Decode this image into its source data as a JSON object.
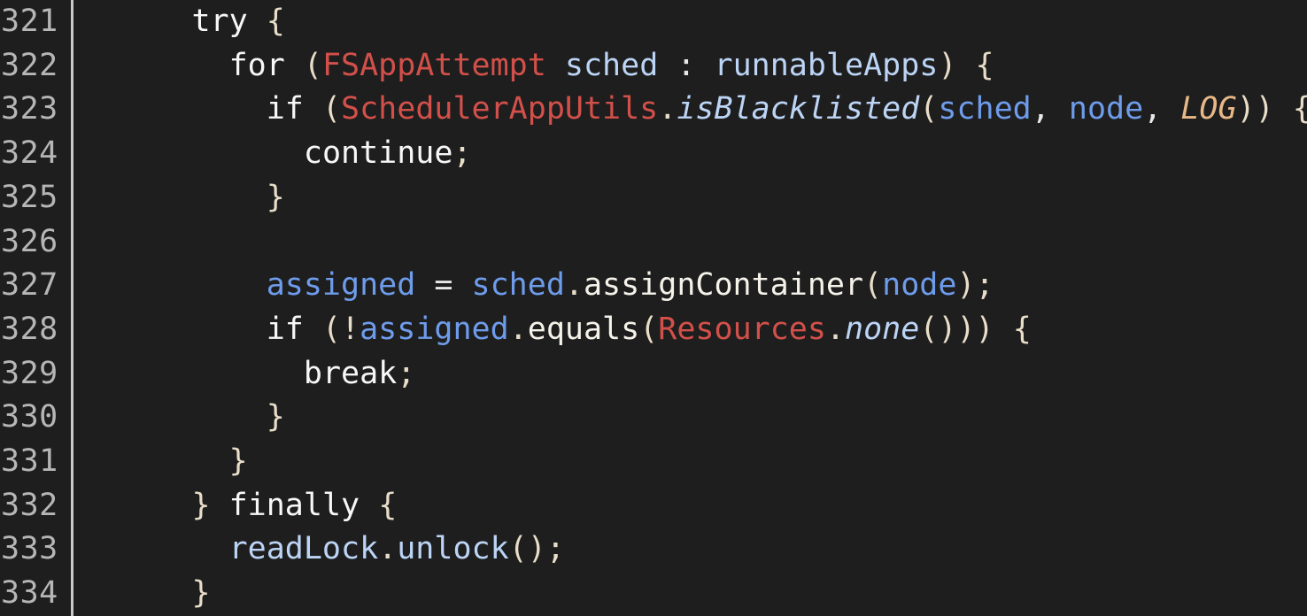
{
  "editor": {
    "background_color": "#1e1e1e",
    "gutter_separator_color": "#c9c9c9",
    "line_number_color": "#b6b6b6",
    "first_line_number": 321,
    "last_line_number": 334,
    "language": "java",
    "palette": {
      "plain": "#f2f2f2",
      "keyword": "#f7f7f7",
      "type": "#d3504a",
      "punctuation": "#e8ddc8",
      "variable": "#6e9ceb",
      "field": "#bcd4f5",
      "static_method": "#bcd4f5",
      "constant": "#e8b887",
      "method": "#f5f2ea"
    }
  },
  "lines": [
    {
      "number": "321",
      "text": "      try {",
      "tokens": [
        {
          "text": "      ",
          "kind": "plain"
        },
        {
          "text": "try",
          "kind": "keyword"
        },
        {
          "text": " ",
          "kind": "plain"
        },
        {
          "text": "{",
          "kind": "punct"
        }
      ]
    },
    {
      "number": "322",
      "text": "        for (FSAppAttempt sched : runnableApps) {",
      "tokens": [
        {
          "text": "        ",
          "kind": "plain"
        },
        {
          "text": "for",
          "kind": "keyword"
        },
        {
          "text": " ",
          "kind": "plain"
        },
        {
          "text": "(",
          "kind": "punct"
        },
        {
          "text": "FSAppAttempt",
          "kind": "type"
        },
        {
          "text": " ",
          "kind": "plain"
        },
        {
          "text": "sched",
          "kind": "field"
        },
        {
          "text": " ",
          "kind": "plain"
        },
        {
          "text": ":",
          "kind": "op"
        },
        {
          "text": " ",
          "kind": "plain"
        },
        {
          "text": "runnableApps",
          "kind": "field"
        },
        {
          "text": ")",
          "kind": "punct"
        },
        {
          "text": " ",
          "kind": "plain"
        },
        {
          "text": "{",
          "kind": "punct"
        }
      ]
    },
    {
      "number": "323",
      "text": "          if (SchedulerAppUtils.isBlacklisted(sched, node, LOG)) {",
      "tokens": [
        {
          "text": "          ",
          "kind": "plain"
        },
        {
          "text": "if",
          "kind": "keyword"
        },
        {
          "text": " ",
          "kind": "plain"
        },
        {
          "text": "(",
          "kind": "punct"
        },
        {
          "text": "SchedulerAppUtils",
          "kind": "type"
        },
        {
          "text": ".",
          "kind": "punct"
        },
        {
          "text": "isBlacklisted",
          "kind": "static"
        },
        {
          "text": "(",
          "kind": "punct"
        },
        {
          "text": "sched",
          "kind": "var"
        },
        {
          "text": ",",
          "kind": "op"
        },
        {
          "text": " ",
          "kind": "plain"
        },
        {
          "text": "node",
          "kind": "var"
        },
        {
          "text": ",",
          "kind": "op"
        },
        {
          "text": " ",
          "kind": "plain"
        },
        {
          "text": "LOG",
          "kind": "const"
        },
        {
          "text": ")",
          "kind": "punct"
        },
        {
          "text": ")",
          "kind": "punct"
        },
        {
          "text": " ",
          "kind": "plain"
        },
        {
          "text": "{",
          "kind": "punct"
        }
      ]
    },
    {
      "number": "324",
      "text": "            continue;",
      "tokens": [
        {
          "text": "            ",
          "kind": "plain"
        },
        {
          "text": "continue",
          "kind": "keyword"
        },
        {
          "text": ";",
          "kind": "punct"
        }
      ]
    },
    {
      "number": "325",
      "text": "          }",
      "tokens": [
        {
          "text": "          ",
          "kind": "plain"
        },
        {
          "text": "}",
          "kind": "punct"
        }
      ]
    },
    {
      "number": "326",
      "text": "",
      "tokens": []
    },
    {
      "number": "327",
      "text": "          assigned = sched.assignContainer(node);",
      "tokens": [
        {
          "text": "          ",
          "kind": "plain"
        },
        {
          "text": "assigned",
          "kind": "var"
        },
        {
          "text": " ",
          "kind": "plain"
        },
        {
          "text": "=",
          "kind": "op"
        },
        {
          "text": " ",
          "kind": "plain"
        },
        {
          "text": "sched",
          "kind": "var"
        },
        {
          "text": ".",
          "kind": "punct"
        },
        {
          "text": "assignContainer",
          "kind": "method"
        },
        {
          "text": "(",
          "kind": "punct"
        },
        {
          "text": "node",
          "kind": "var"
        },
        {
          "text": ")",
          "kind": "punct"
        },
        {
          "text": ";",
          "kind": "punct"
        }
      ]
    },
    {
      "number": "328",
      "text": "          if (!assigned.equals(Resources.none())) {",
      "tokens": [
        {
          "text": "          ",
          "kind": "plain"
        },
        {
          "text": "if",
          "kind": "keyword"
        },
        {
          "text": " ",
          "kind": "plain"
        },
        {
          "text": "(",
          "kind": "punct"
        },
        {
          "text": "!",
          "kind": "punct"
        },
        {
          "text": "assigned",
          "kind": "var"
        },
        {
          "text": ".",
          "kind": "punct"
        },
        {
          "text": "equals",
          "kind": "method"
        },
        {
          "text": "(",
          "kind": "punct"
        },
        {
          "text": "Resources",
          "kind": "type"
        },
        {
          "text": ".",
          "kind": "punct"
        },
        {
          "text": "none",
          "kind": "static"
        },
        {
          "text": "(",
          "kind": "punct"
        },
        {
          "text": ")",
          "kind": "punct"
        },
        {
          "text": ")",
          "kind": "punct"
        },
        {
          "text": ")",
          "kind": "punct"
        },
        {
          "text": " ",
          "kind": "plain"
        },
        {
          "text": "{",
          "kind": "punct"
        }
      ]
    },
    {
      "number": "329",
      "text": "            break;",
      "tokens": [
        {
          "text": "            ",
          "kind": "plain"
        },
        {
          "text": "break",
          "kind": "keyword"
        },
        {
          "text": ";",
          "kind": "punct"
        }
      ]
    },
    {
      "number": "330",
      "text": "          }",
      "tokens": [
        {
          "text": "          ",
          "kind": "plain"
        },
        {
          "text": "}",
          "kind": "punct"
        }
      ]
    },
    {
      "number": "331",
      "text": "        }",
      "tokens": [
        {
          "text": "        ",
          "kind": "plain"
        },
        {
          "text": "}",
          "kind": "punct"
        }
      ]
    },
    {
      "number": "332",
      "text": "      } finally {",
      "tokens": [
        {
          "text": "      ",
          "kind": "plain"
        },
        {
          "text": "}",
          "kind": "punct"
        },
        {
          "text": " ",
          "kind": "plain"
        },
        {
          "text": "finally",
          "kind": "keyword"
        },
        {
          "text": " ",
          "kind": "plain"
        },
        {
          "text": "{",
          "kind": "punct"
        }
      ]
    },
    {
      "number": "333",
      "text": "        readLock.unlock();",
      "tokens": [
        {
          "text": "        ",
          "kind": "plain"
        },
        {
          "text": "readLock",
          "kind": "field"
        },
        {
          "text": ".",
          "kind": "punct"
        },
        {
          "text": "unlock",
          "kind": "field"
        },
        {
          "text": "(",
          "kind": "punct"
        },
        {
          "text": ")",
          "kind": "punct"
        },
        {
          "text": ";",
          "kind": "punct"
        }
      ]
    },
    {
      "number": "334",
      "text": "      }",
      "tokens": [
        {
          "text": "      ",
          "kind": "plain"
        },
        {
          "text": "}",
          "kind": "punct"
        }
      ]
    }
  ]
}
